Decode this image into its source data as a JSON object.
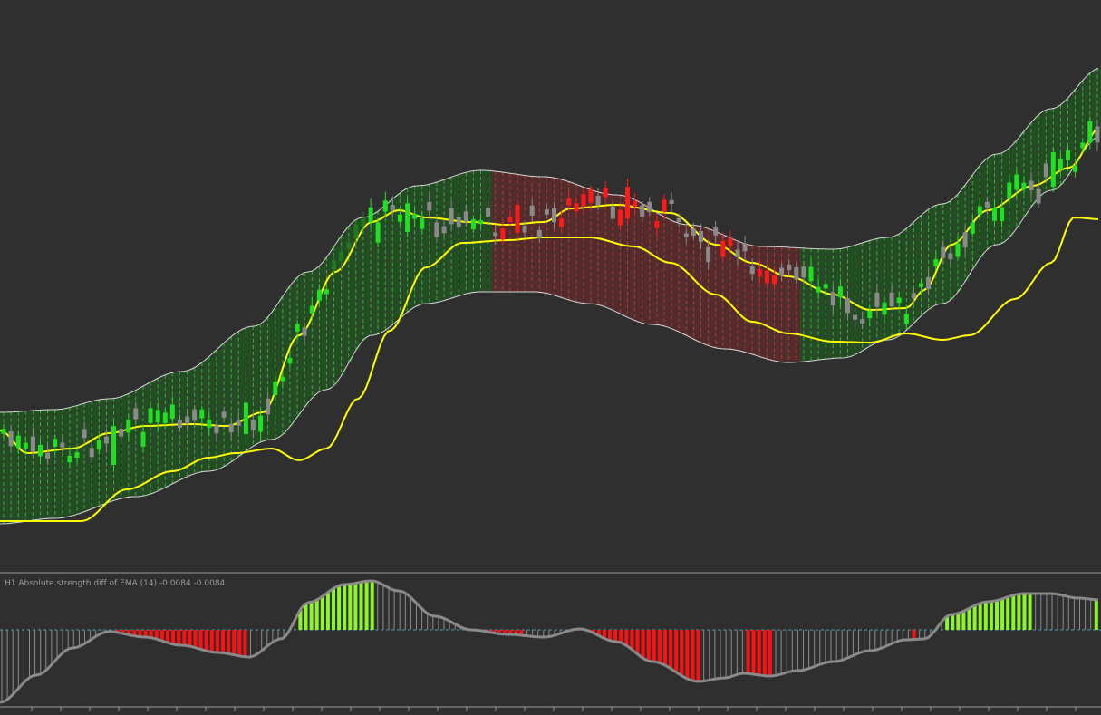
{
  "indicator": {
    "label": "H1 Absolute strength diff of EMA (14) -0.0084 -0.0084"
  },
  "colors": {
    "background": "#2f2f2f",
    "bull_candle": "#21e021",
    "bull_candle_dark": "#1f7a1f",
    "bear_candle": "#ff1a1a",
    "neutral_candle": "#8a8a8a",
    "channel_fill_up": "#1f5e1f",
    "channel_fill_down": "#6e2a2a",
    "channel_line_up": "#3ccc3c",
    "channel_line_down": "#cc3c3c",
    "band_outline": "#d8d8d8",
    "ma_line": "#ffff00",
    "hist_up": "#8ef52a",
    "hist_down": "#ff1010",
    "hist_neutral": "#8c8c8c",
    "oscillator_line": "#8a8a8a",
    "zero_line": "#4a9fb0",
    "separator": "#9a9a9a"
  },
  "chart_data": [
    {
      "type": "candlestick",
      "title": "",
      "overlays": [
        "upper band",
        "lower band",
        "fast moving average",
        "slow moving average"
      ],
      "candle_count": 150,
      "trend_segments": [
        {
          "from_bar": 0,
          "to_bar": 66,
          "direction": "up"
        },
        {
          "from_bar": 67,
          "to_bar": 108,
          "direction": "down"
        },
        {
          "from_bar": 109,
          "to_bar": 149,
          "direction": "up"
        }
      ]
    },
    {
      "type": "histogram",
      "title": "H1 Absolute strength diff of EMA (14) -0.0084 -0.0084",
      "zero_line": true,
      "value_count": 150,
      "value_range": [
        -1,
        1
      ]
    }
  ]
}
